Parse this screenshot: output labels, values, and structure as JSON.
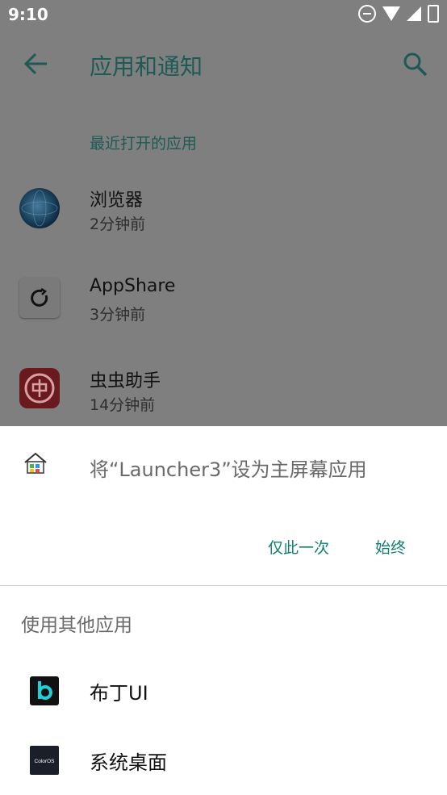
{
  "status_bar": {
    "time": "9:10",
    "icons": [
      "do-not-disturb-icon",
      "wifi-icon",
      "signal-icon",
      "battery-icon"
    ]
  },
  "app_bar": {
    "title": "应用和通知",
    "back_icon": "arrow-left-icon",
    "search_icon": "search-icon"
  },
  "recent": {
    "section_title": "最近打开的应用",
    "items": [
      {
        "name": "浏览器",
        "time": "2分钟前",
        "icon": "browser-globe-icon"
      },
      {
        "name": "AppShare",
        "time": "3分钟前",
        "icon": "appshare-icon"
      },
      {
        "name": "虫虫助手",
        "time": "14分钟前",
        "icon": "chongchong-icon"
      }
    ]
  },
  "sheet": {
    "prompt": "将“Launcher3”设为主屏幕应用",
    "buttons": {
      "once": "仅此一次",
      "always": "始终"
    },
    "other_apps_label": "使用其他应用",
    "apps": [
      {
        "name": "布丁UI",
        "icon": "buding-ui-icon"
      },
      {
        "name": "系统桌面",
        "icon": "coloros-icon",
        "icon_text": "ColorOS"
      }
    ]
  },
  "colors": {
    "accent": "#128071",
    "scrim_background": "#7f7f7f",
    "sheet_background": "#ffffff"
  }
}
